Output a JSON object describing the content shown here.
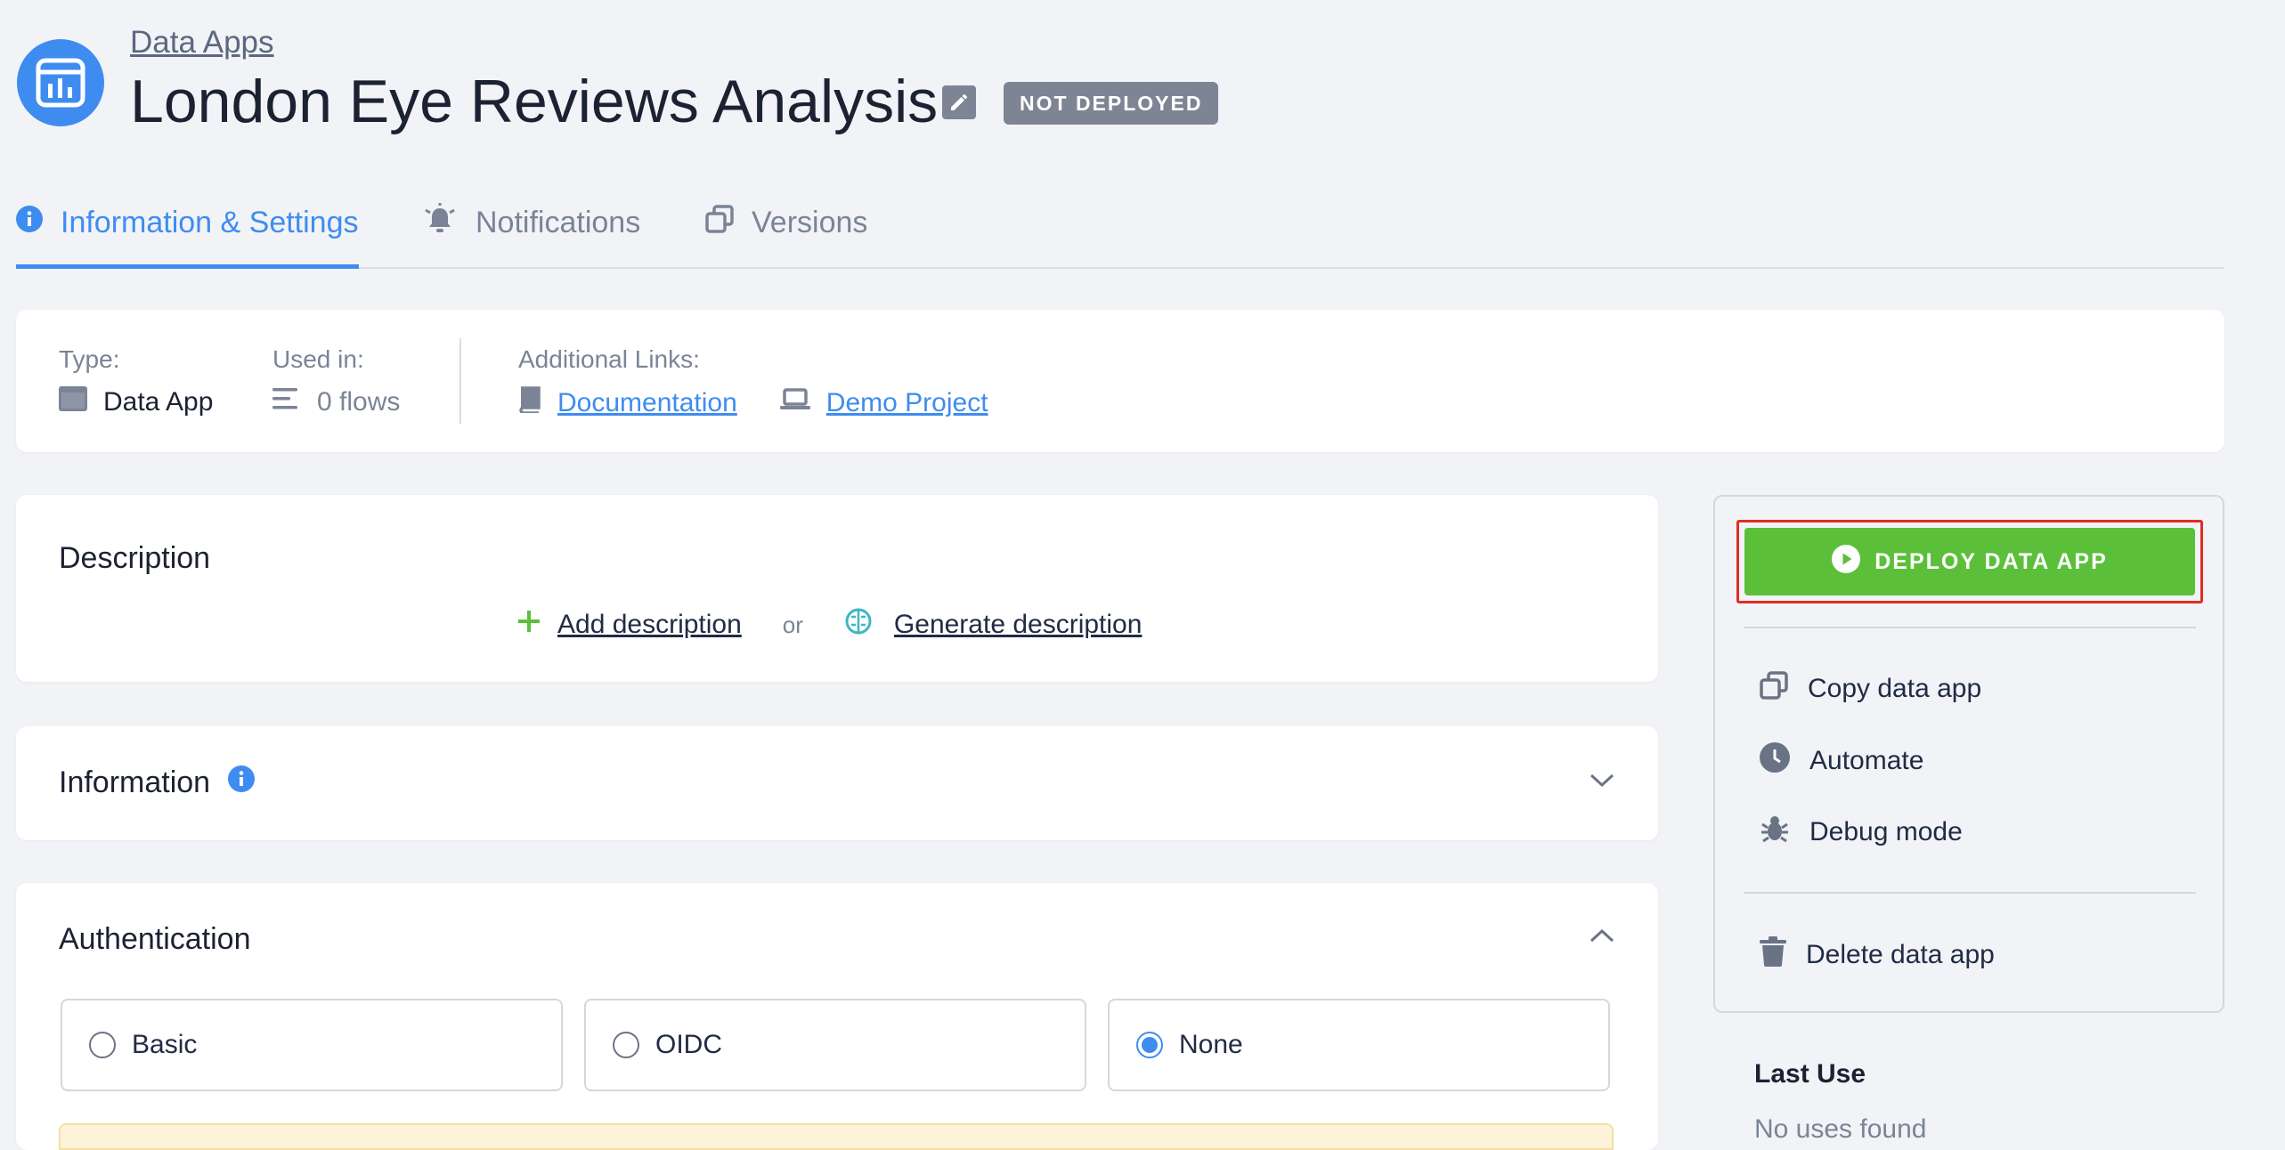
{
  "breadcrumb": {
    "label": "Data Apps"
  },
  "header": {
    "title": "London Eye Reviews Analysis",
    "status": "NOT DEPLOYED"
  },
  "tabs": [
    {
      "label": "Information & Settings",
      "icon": "info-icon",
      "active": true
    },
    {
      "label": "Notifications",
      "icon": "bell-icon"
    },
    {
      "label": "Versions",
      "icon": "versions-icon"
    }
  ],
  "meta": {
    "type_label": "Type:",
    "type_value": "Data App",
    "used_label": "Used in:",
    "used_value": "0 flows",
    "links_label": "Additional Links:",
    "links": [
      {
        "label": "Documentation",
        "icon": "book-icon"
      },
      {
        "label": "Demo Project",
        "icon": "laptop-icon"
      }
    ]
  },
  "description": {
    "title": "Description",
    "add_label": "Add description",
    "or_label": "or",
    "generate_label": "Generate description"
  },
  "information": {
    "title": "Information"
  },
  "authentication": {
    "title": "Authentication",
    "options": [
      {
        "label": "Basic",
        "checked": false
      },
      {
        "label": "OIDC",
        "checked": false
      },
      {
        "label": "None",
        "checked": true
      }
    ]
  },
  "side": {
    "deploy_label": "DEPLOY DATA APP",
    "copy_label": "Copy data app",
    "automate_label": "Automate",
    "debug_label": "Debug mode",
    "delete_label": "Delete data app"
  },
  "last_use": {
    "title": "Last Use",
    "text": "No uses found"
  },
  "colors": {
    "accent": "#3f8cf0",
    "deploy": "#5bbf3a",
    "highlight": "#e02d22",
    "badge": "#7d8595"
  }
}
